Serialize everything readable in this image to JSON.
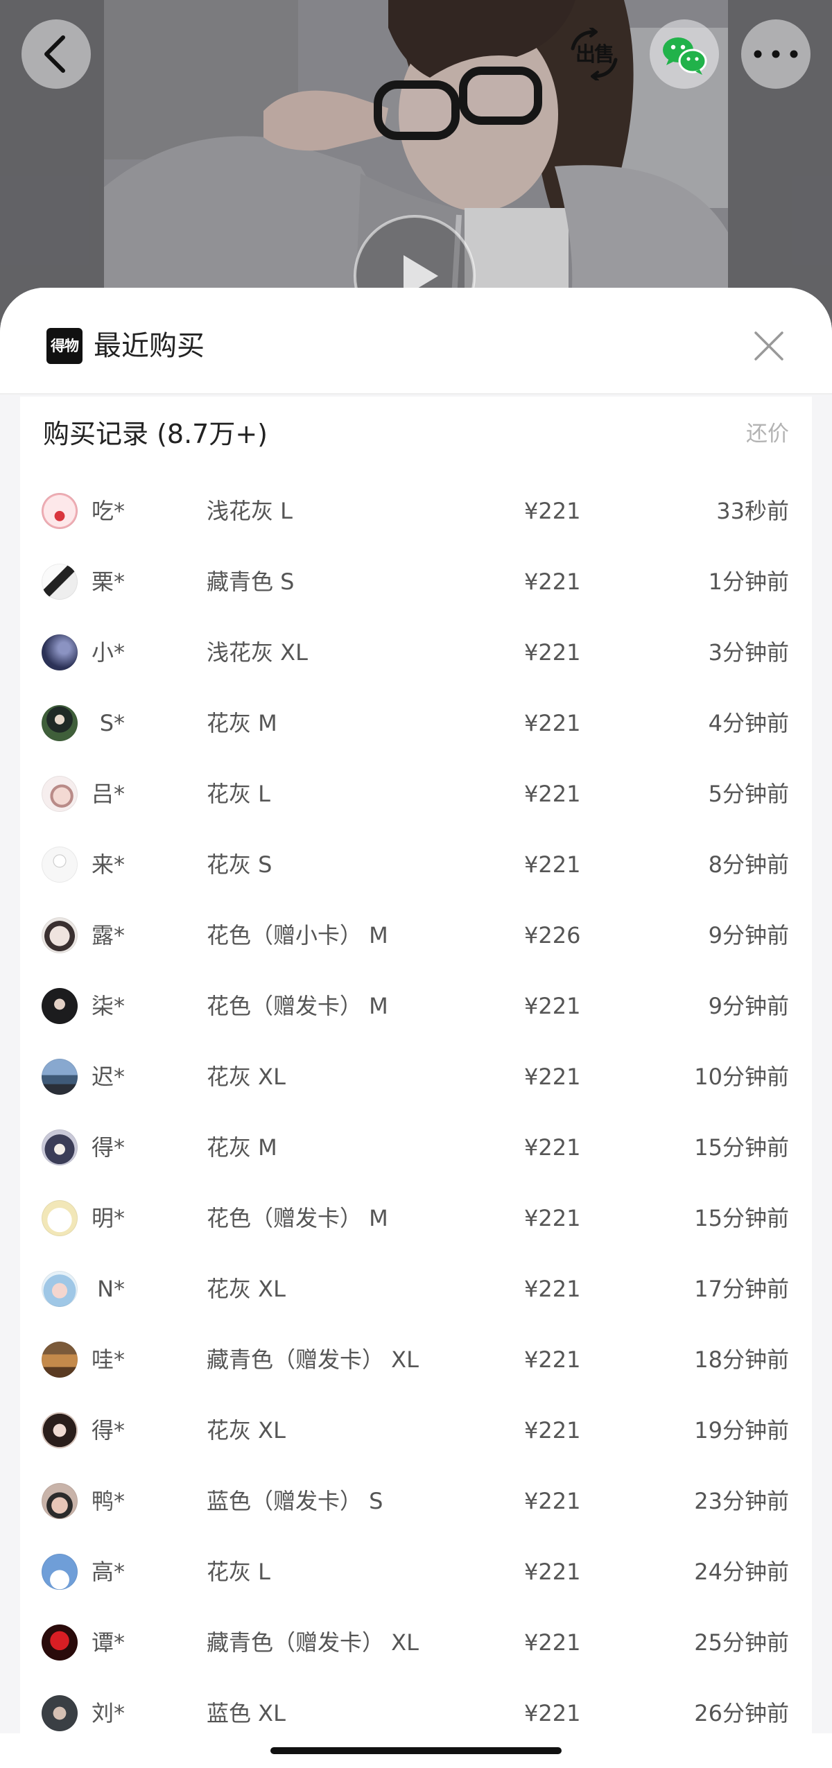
{
  "top_bar": {
    "back_icon": "chevron-left-icon",
    "sell_label": "出售",
    "sell_icon": "exchange-arrows-icon",
    "share_icon": "wechat-icon",
    "more_icon": "more-horizontal-icon"
  },
  "hero": {
    "play_icon": "play-icon"
  },
  "sheet": {
    "logo_text": "得物",
    "title": "最近购买",
    "close_icon": "close-icon"
  },
  "records": {
    "title": "购买记录 (8.7万+)",
    "bargain_label": "还价",
    "rows": [
      {
        "name": "吃*",
        "spec": "浅花灰 L",
        "price": "¥221",
        "time": "33秒前"
      },
      {
        "name": "栗*",
        "spec": "藏青色 S",
        "price": "¥221",
        "time": "1分钟前"
      },
      {
        "name": "小*",
        "spec": "浅花灰 XL",
        "price": "¥221",
        "time": "3分钟前"
      },
      {
        "name": "S*",
        "spec": "花灰 M",
        "price": "¥221",
        "time": "4分钟前"
      },
      {
        "name": "吕*",
        "spec": "花灰 L",
        "price": "¥221",
        "time": "5分钟前"
      },
      {
        "name": "来*",
        "spec": "花灰 S",
        "price": "¥221",
        "time": "8分钟前"
      },
      {
        "name": "露*",
        "spec": "花色（赠小卡） M",
        "price": "¥226",
        "time": "9分钟前"
      },
      {
        "name": "柒*",
        "spec": "花色（赠发卡） M",
        "price": "¥221",
        "time": "9分钟前"
      },
      {
        "name": "迟*",
        "spec": "花灰 XL",
        "price": "¥221",
        "time": "10分钟前"
      },
      {
        "name": "得*",
        "spec": "花灰 M",
        "price": "¥221",
        "time": "15分钟前"
      },
      {
        "name": "明*",
        "spec": "花色（赠发卡） M",
        "price": "¥221",
        "time": "15分钟前"
      },
      {
        "name": "N*",
        "spec": "花灰 XL",
        "price": "¥221",
        "time": "17分钟前"
      },
      {
        "name": "哇*",
        "spec": "藏青色（赠发卡） XL",
        "price": "¥221",
        "time": "18分钟前"
      },
      {
        "name": "得*",
        "spec": "花灰 XL",
        "price": "¥221",
        "time": "19分钟前"
      },
      {
        "name": "鸭*",
        "spec": "蓝色（赠发卡） S",
        "price": "¥221",
        "time": "23分钟前"
      },
      {
        "name": "高*",
        "spec": "花灰 L",
        "price": "¥221",
        "time": "24分钟前"
      },
      {
        "name": "谭*",
        "spec": "藏青色（赠发卡） XL",
        "price": "¥221",
        "time": "25分钟前"
      },
      {
        "name": "刘*",
        "spec": "蓝色 XL",
        "price": "¥221",
        "time": "26分钟前"
      }
    ]
  },
  "colors": {
    "text_primary": "#222222",
    "text_secondary": "#555555",
    "text_muted": "#b3b3b3",
    "wechat_green": "#21b24a",
    "sheet_background": "#f5f5f7",
    "logo_background": "#111111"
  }
}
